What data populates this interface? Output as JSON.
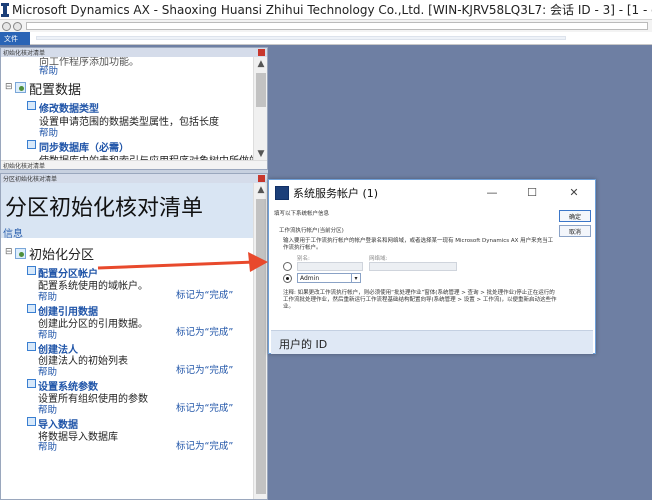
{
  "window": {
    "title": "Microsoft Dynamics AX - Shaoxing Huansi Zhihui Technology Co.,Ltd. [WIN-KJRV58LQ3L7: 会话 ID - 3] -  [1 - dat]"
  },
  "ribbon": {
    "file_label": "文件"
  },
  "top_pane": {
    "header": "初始化核对清单",
    "cut_line": "向工作程序添加功能。",
    "cut_help": "帮助",
    "section": "配置数据",
    "tasks": [
      {
        "title": "修改数据类型",
        "desc": "设置申请范围的数据类型属性，包括长度",
        "help": "帮助"
      },
      {
        "title": "同步数据库（必需）",
        "desc": "使数据库中的表和索引与应用程序对象树中所做的",
        "help": ""
      }
    ],
    "footer": "初始化核对清单"
  },
  "bottom_pane": {
    "header": "分区初始化核对清单",
    "title": "分区初始化核对清单",
    "info": "信息",
    "group": "初始化分区",
    "tasks": [
      {
        "title": "配置分区帐户",
        "desc": "配置系统使用的域帐户。",
        "help": "帮助",
        "mark": "标记为“完成”"
      },
      {
        "title": "创建引用数据",
        "desc": "创建此分区的引用数据。",
        "help": "帮助",
        "mark": "标记为“完成”"
      },
      {
        "title": "创建法人",
        "desc": "创建法人的初始列表",
        "help": "帮助",
        "mark": "标记为“完成”"
      },
      {
        "title": "设置系统参数",
        "desc": "设置所有组织使用的参数",
        "help": "帮助",
        "mark": "标记为“完成”"
      },
      {
        "title": "导入数据",
        "desc": "将数据导入数据库",
        "help": "帮助",
        "mark": "标记为“完成”"
      }
    ]
  },
  "dialog": {
    "title": "系统服务帐户 (1)",
    "minimize": "—",
    "maximize": "☐",
    "close": "✕",
    "heading": "填写以下系统帐户信息",
    "group_label": "工作流执行帐户(当前分区)",
    "instructions_1": "输入要用于工作流执行帐户的帐户登录名和网络域，或者选择某一现有 Microsoft Dynamics AX 用户来充当工",
    "instructions_2": "作流执行帐户。",
    "alias_label": "别名:",
    "domain_label": "网络域:",
    "user_value": "Admin",
    "note_1": "注释: 如果更改工作流执行帐户，则必须使用“批处理作业”窗体(系统管理 > 查询 > 批处理作业)停止正在运行的",
    "note_2": "工作流批处理作业，然后重新运行工作流程基础结构配置向导(系统管理 > 设置 > 工作流)，以便重新启动这些作",
    "note_3": "业。",
    "ok_label": "确定",
    "cancel_label": "取消",
    "footer": "用户的 ID"
  },
  "colors": {
    "arrow": "#e8492c",
    "link": "#1f54a8",
    "workspace": "#6e7fa3"
  }
}
